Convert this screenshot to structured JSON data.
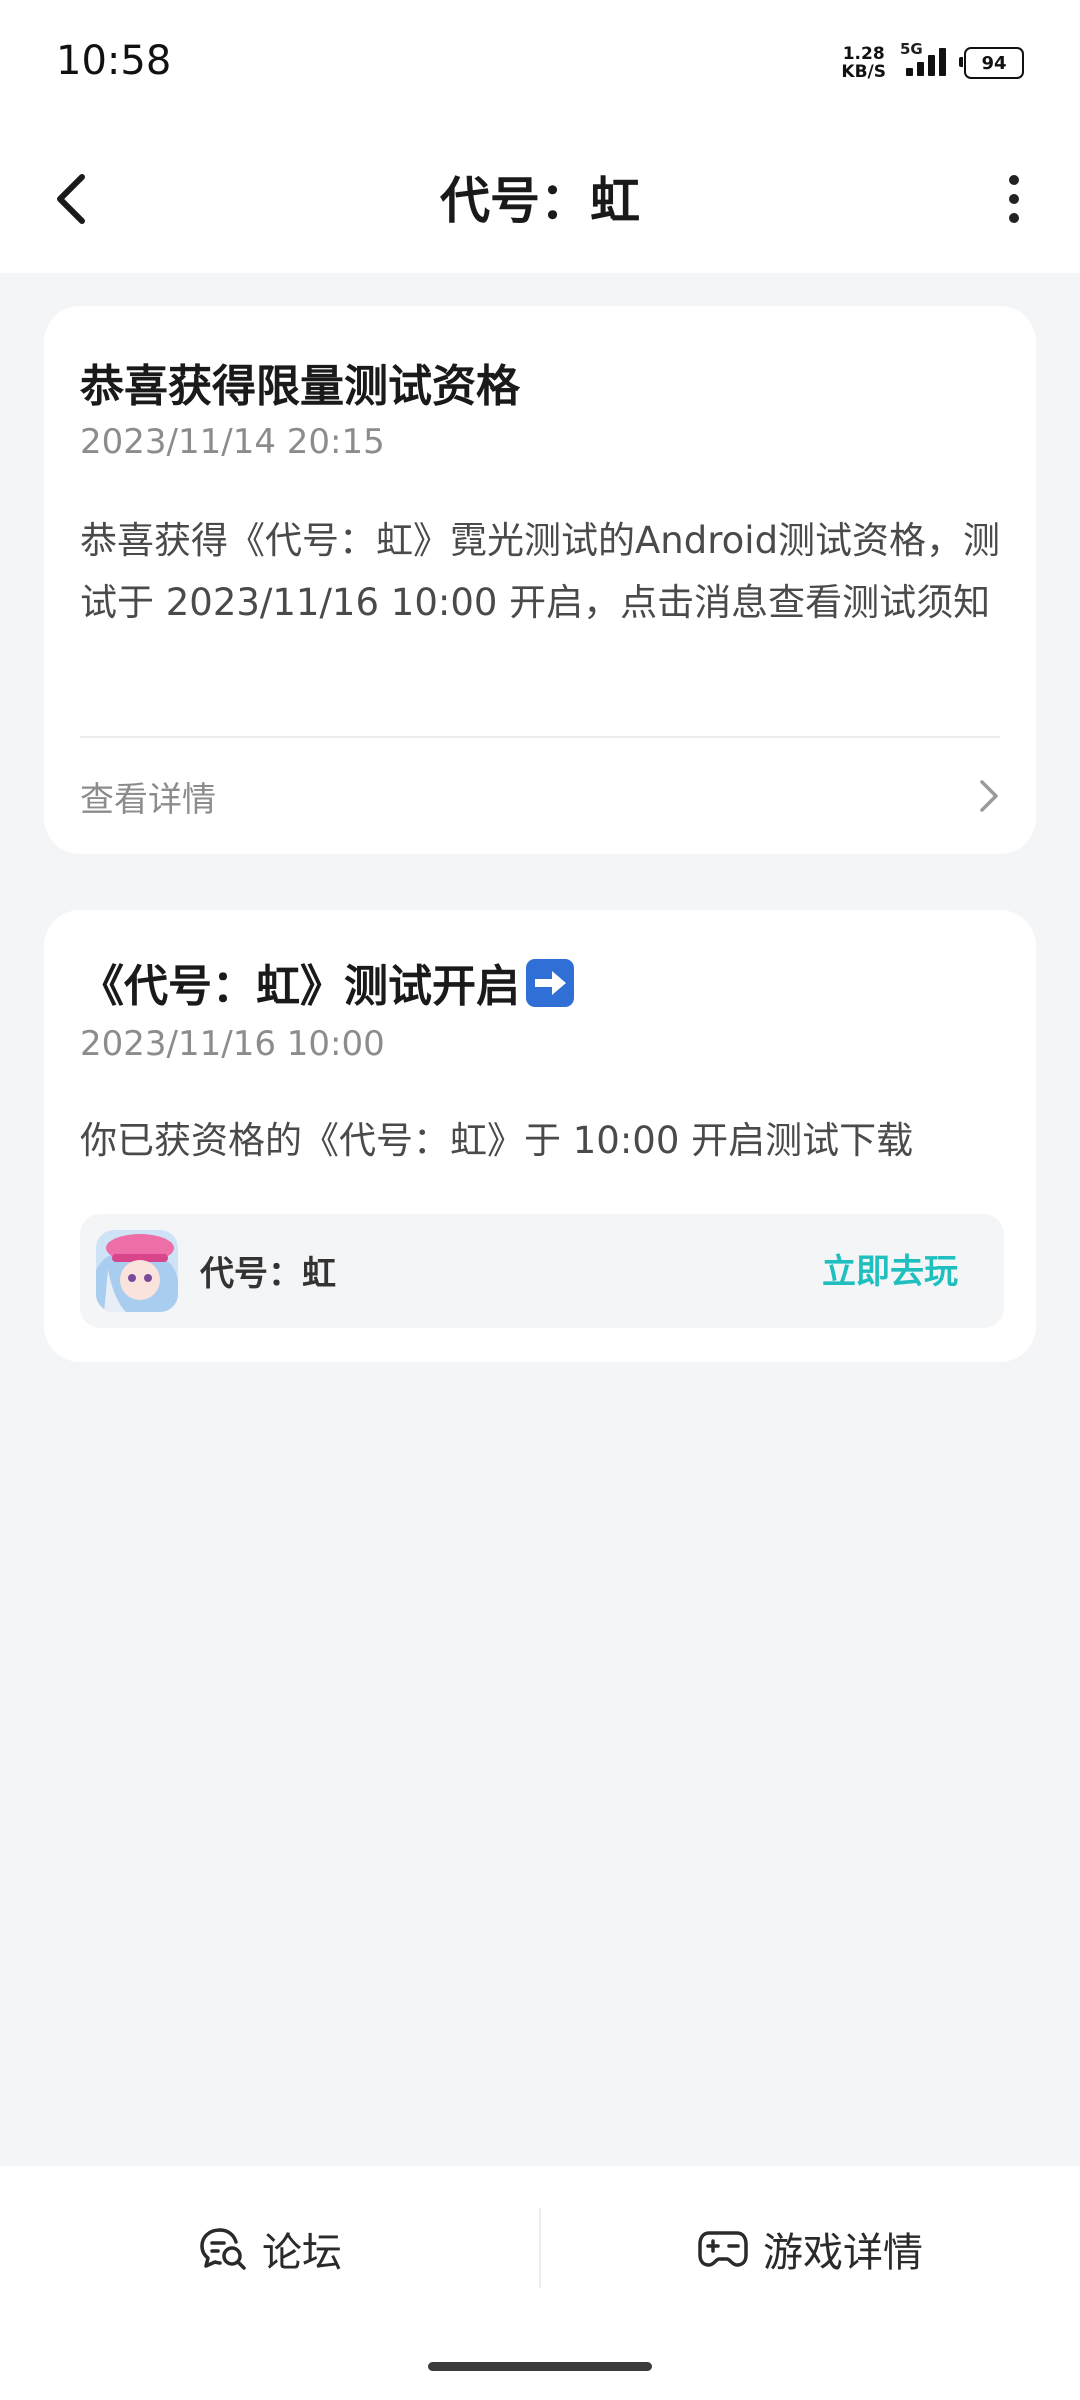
{
  "status_bar": {
    "time": "10:58",
    "net_speed_value": "1.28",
    "net_speed_unit": "KB/S",
    "network": "5G",
    "battery": "94"
  },
  "header": {
    "title": "代号：虹",
    "back_icon": "chevron-left-icon",
    "more_icon": "more-vertical-icon"
  },
  "messages": [
    {
      "title": "恭喜获得限量测试资格",
      "date": "2023/11/14 20:15",
      "body": "恭喜获得《代号：虹》霓光测试的Android测试资格，测试于 2023/11/16 10:00 开启，点击消息查看测试须知",
      "link_label": "查看详情"
    },
    {
      "title": "《代号：虹》测试开启",
      "title_emoji": "right-arrow-emoji-icon",
      "date": "2023/11/16 10:00",
      "body": "你已获资格的《代号：虹》于 10:00 开启测试下载",
      "game": {
        "name": "代号：虹",
        "action": "立即去玩"
      }
    }
  ],
  "bottom_tabs": [
    {
      "label": "论坛",
      "icon": "chat-search-icon"
    },
    {
      "label": "游戏详情",
      "icon": "gamepad-icon"
    }
  ],
  "colors": {
    "accent": "#1fbfc0",
    "background": "#f4f5f7"
  }
}
